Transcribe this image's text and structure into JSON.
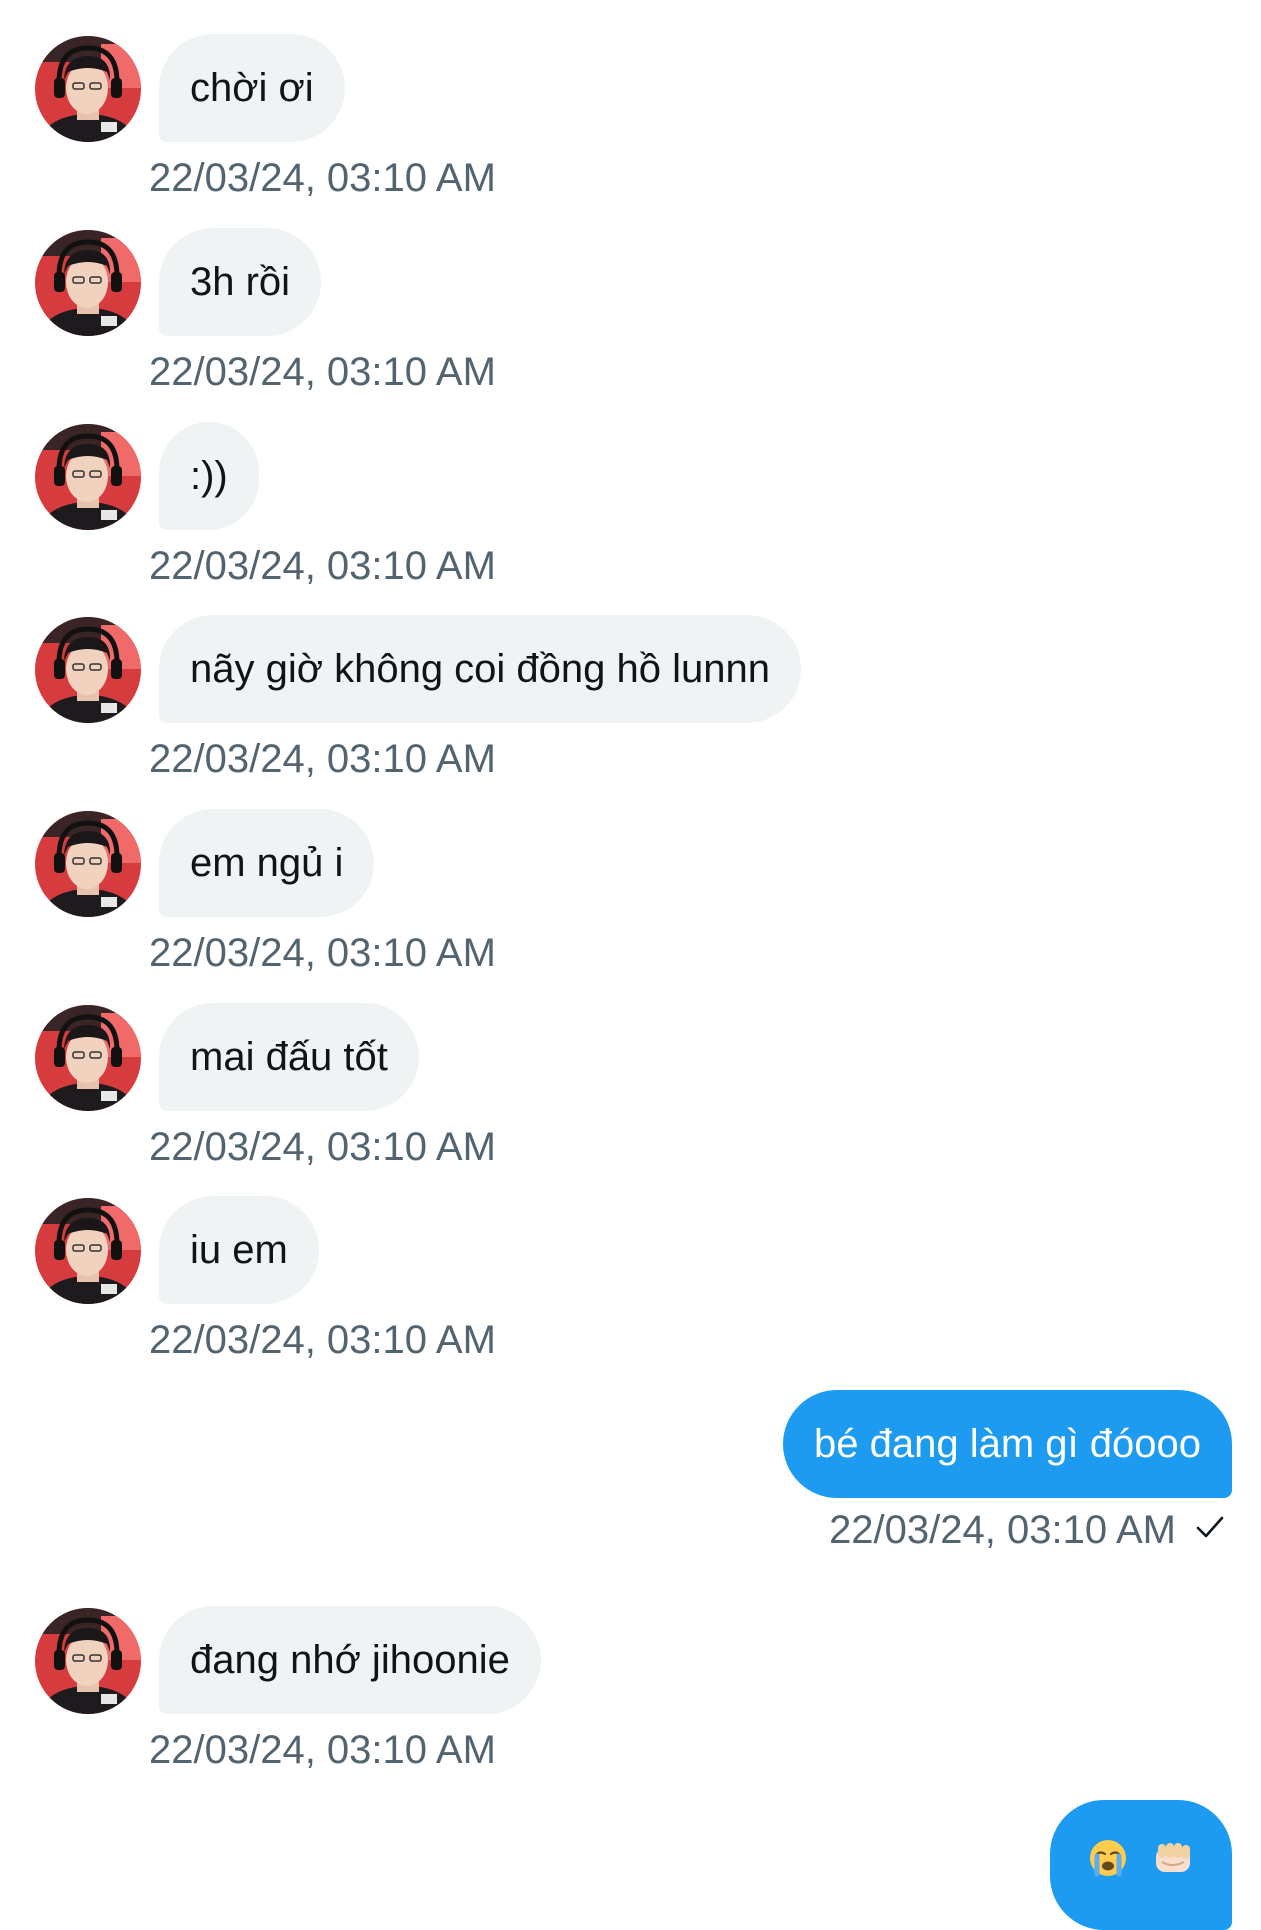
{
  "colors": {
    "incoming_bubble": "#eff3f4",
    "outgoing_bubble": "#1d9bf0",
    "text": "#0f1419",
    "timestamp": "#536471"
  },
  "messages": [
    {
      "from": "them",
      "text": "chời ơi",
      "time": "22/03/24, 03:10 AM"
    },
    {
      "from": "them",
      "text": "3h rồi",
      "time": "22/03/24, 03:10 AM"
    },
    {
      "from": "them",
      "text": ":))",
      "time": "22/03/24, 03:10 AM"
    },
    {
      "from": "them",
      "text": "nãy giờ không coi đồng hồ lunnn",
      "time": "22/03/24, 03:10 AM"
    },
    {
      "from": "them",
      "text": "em ngủ i",
      "time": "22/03/24, 03:10 AM"
    },
    {
      "from": "them",
      "text": "mai đấu tốt",
      "time": "22/03/24, 03:10 AM"
    },
    {
      "from": "them",
      "text": "iu em",
      "time": "22/03/24, 03:10 AM"
    },
    {
      "from": "me",
      "text": "bé đang làm gì đóooo",
      "time": "22/03/24, 03:10 AM",
      "status_icon": "check-icon"
    },
    {
      "from": "them",
      "text": "đang nhớ jihoonie",
      "time": "22/03/24, 03:10 AM"
    },
    {
      "from": "me",
      "emojis": [
        "loudly-crying-face-emoji",
        "oncoming-fist-emoji"
      ]
    }
  ]
}
